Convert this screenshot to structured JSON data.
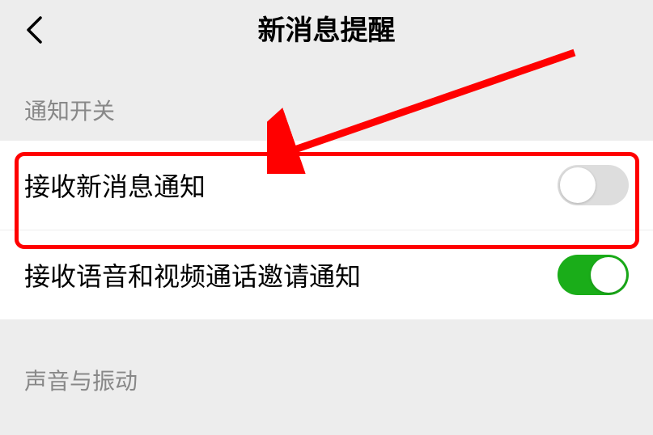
{
  "header": {
    "title": "新消息提醒"
  },
  "sections": {
    "notification_switch": {
      "label": "通知开关",
      "items": [
        {
          "label": "接收新消息通知",
          "enabled": false
        },
        {
          "label": "接收语音和视频通话邀请通知",
          "enabled": true
        }
      ]
    },
    "sound_vibration": {
      "label": "声音与振动"
    }
  }
}
